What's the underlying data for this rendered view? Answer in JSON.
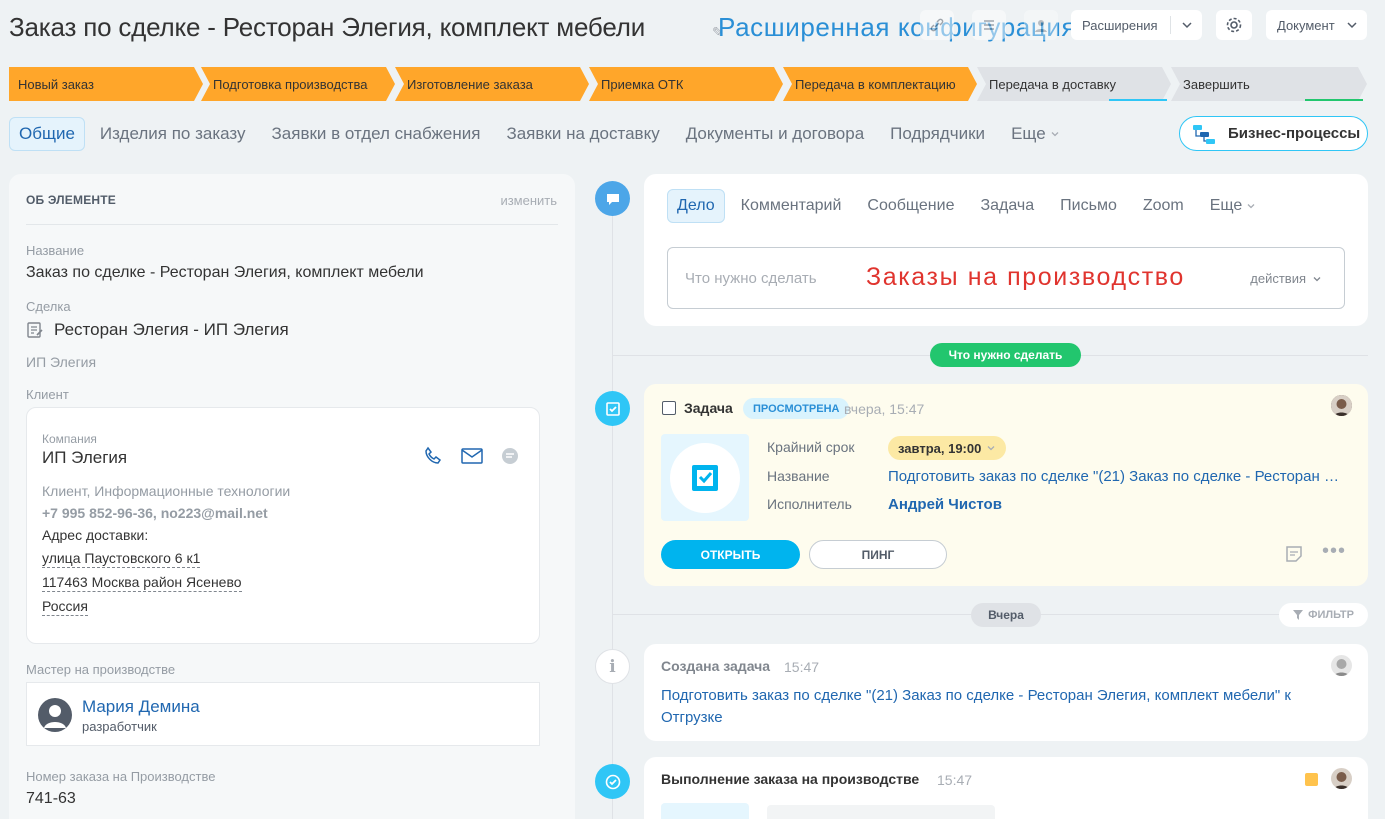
{
  "header": {
    "title": "Заказ по сделке - Ресторан Элегия, комплект мебели",
    "overlay_text": "Расширенная конфигурация",
    "extensions_label": "Расширения",
    "document_label": "Документ"
  },
  "stages": [
    {
      "label": "Новый заказ",
      "state": "done"
    },
    {
      "label": "Подготовка производства",
      "state": "done"
    },
    {
      "label": "Изготовление заказа",
      "state": "done"
    },
    {
      "label": "Приемка ОТК",
      "state": "done"
    },
    {
      "label": "Передача в комплектацию",
      "state": "done"
    },
    {
      "label": "Передача в доставку",
      "state": "todo"
    },
    {
      "label": "Завершить",
      "state": "todo"
    }
  ],
  "tabs": [
    {
      "label": "Общие",
      "active": true
    },
    {
      "label": "Изделия по заказу"
    },
    {
      "label": "Заявки в отдел снабжения"
    },
    {
      "label": "Заявки на доставку"
    },
    {
      "label": "Документы и договора"
    },
    {
      "label": "Подрядчики"
    },
    {
      "label": "Еще"
    }
  ],
  "bp_button": "Бизнес-процессы",
  "about": {
    "heading": "ОБ ЭЛЕМЕНТЕ",
    "edit_link": "изменить",
    "name_label": "Название",
    "name_value": "Заказ по сделке - Ресторан Элегия, комплект мебели",
    "deal_label": "Сделка",
    "deal_value": "Ресторан Элегия - ИП Элегия",
    "deal_company": "ИП Элегия",
    "client_label": "Клиент",
    "client": {
      "company_label": "Компания",
      "company_name": "ИП Элегия",
      "type": "Клиент, Информационные технологии",
      "contacts": "+7 995 852-96-36, no223@mail.net",
      "address_label": "Адрес доставки:",
      "address_line1": "улица Паустовского 6 к1",
      "address_line2": "117463 Москва район Ясенево",
      "address_line3": "Россия"
    },
    "master_label": "Мастер на производстве",
    "master_name": "Мария Демина",
    "master_role": "разработчик",
    "order_no_label": "Номер заказа на Производстве",
    "order_no_value": "741-63"
  },
  "editor": {
    "tabs": [
      {
        "label": "Дело",
        "active": true
      },
      {
        "label": "Комментарий"
      },
      {
        "label": "Сообщение"
      },
      {
        "label": "Задача"
      },
      {
        "label": "Письмо"
      },
      {
        "label": "Zoom"
      },
      {
        "label": "Еще"
      }
    ],
    "placeholder": "Что нужно сделать",
    "overlay_text": "Заказы на производство",
    "actions_label": "действия"
  },
  "timeline": {
    "todo_pill": "Что нужно сделать",
    "task": {
      "title": "Задача",
      "badge": "ПРОСМОТРЕНА",
      "time": "вчера, 15:47",
      "deadline_label": "Крайний срок",
      "deadline_value": "завтра, 19:00",
      "name_label": "Название",
      "name_value": "Подготовить заказ по сделке \"(21) Заказ по сделке - Ресторан Элегия, комплект мебели\" к Отгрузке",
      "assignee_label": "Исполнитель",
      "assignee_value": "Андрей Чистов",
      "open_button": "ОТКРЫТЬ",
      "ping_button": "ПИНГ"
    },
    "yesterday_pill": "Вчера",
    "filter_pill": "ФИЛЬТР",
    "created_event": {
      "title": "Создана задача",
      "time": "15:47",
      "text": "Подготовить заказ по сделке \"(21) Заказ по сделке - Ресторан Элегия, комплект мебели\" к Отгрузке"
    },
    "execution_event": {
      "title": "Выполнение заказа на производстве",
      "time": "15:47"
    }
  },
  "colors": {
    "stage_done": "#ffa62a",
    "stage_todo": "#dfe2e6",
    "accent_blue": "#2fc6f6",
    "link_blue": "#2067b0",
    "green": "#22c66e",
    "overlay_red": "#e0342e"
  }
}
